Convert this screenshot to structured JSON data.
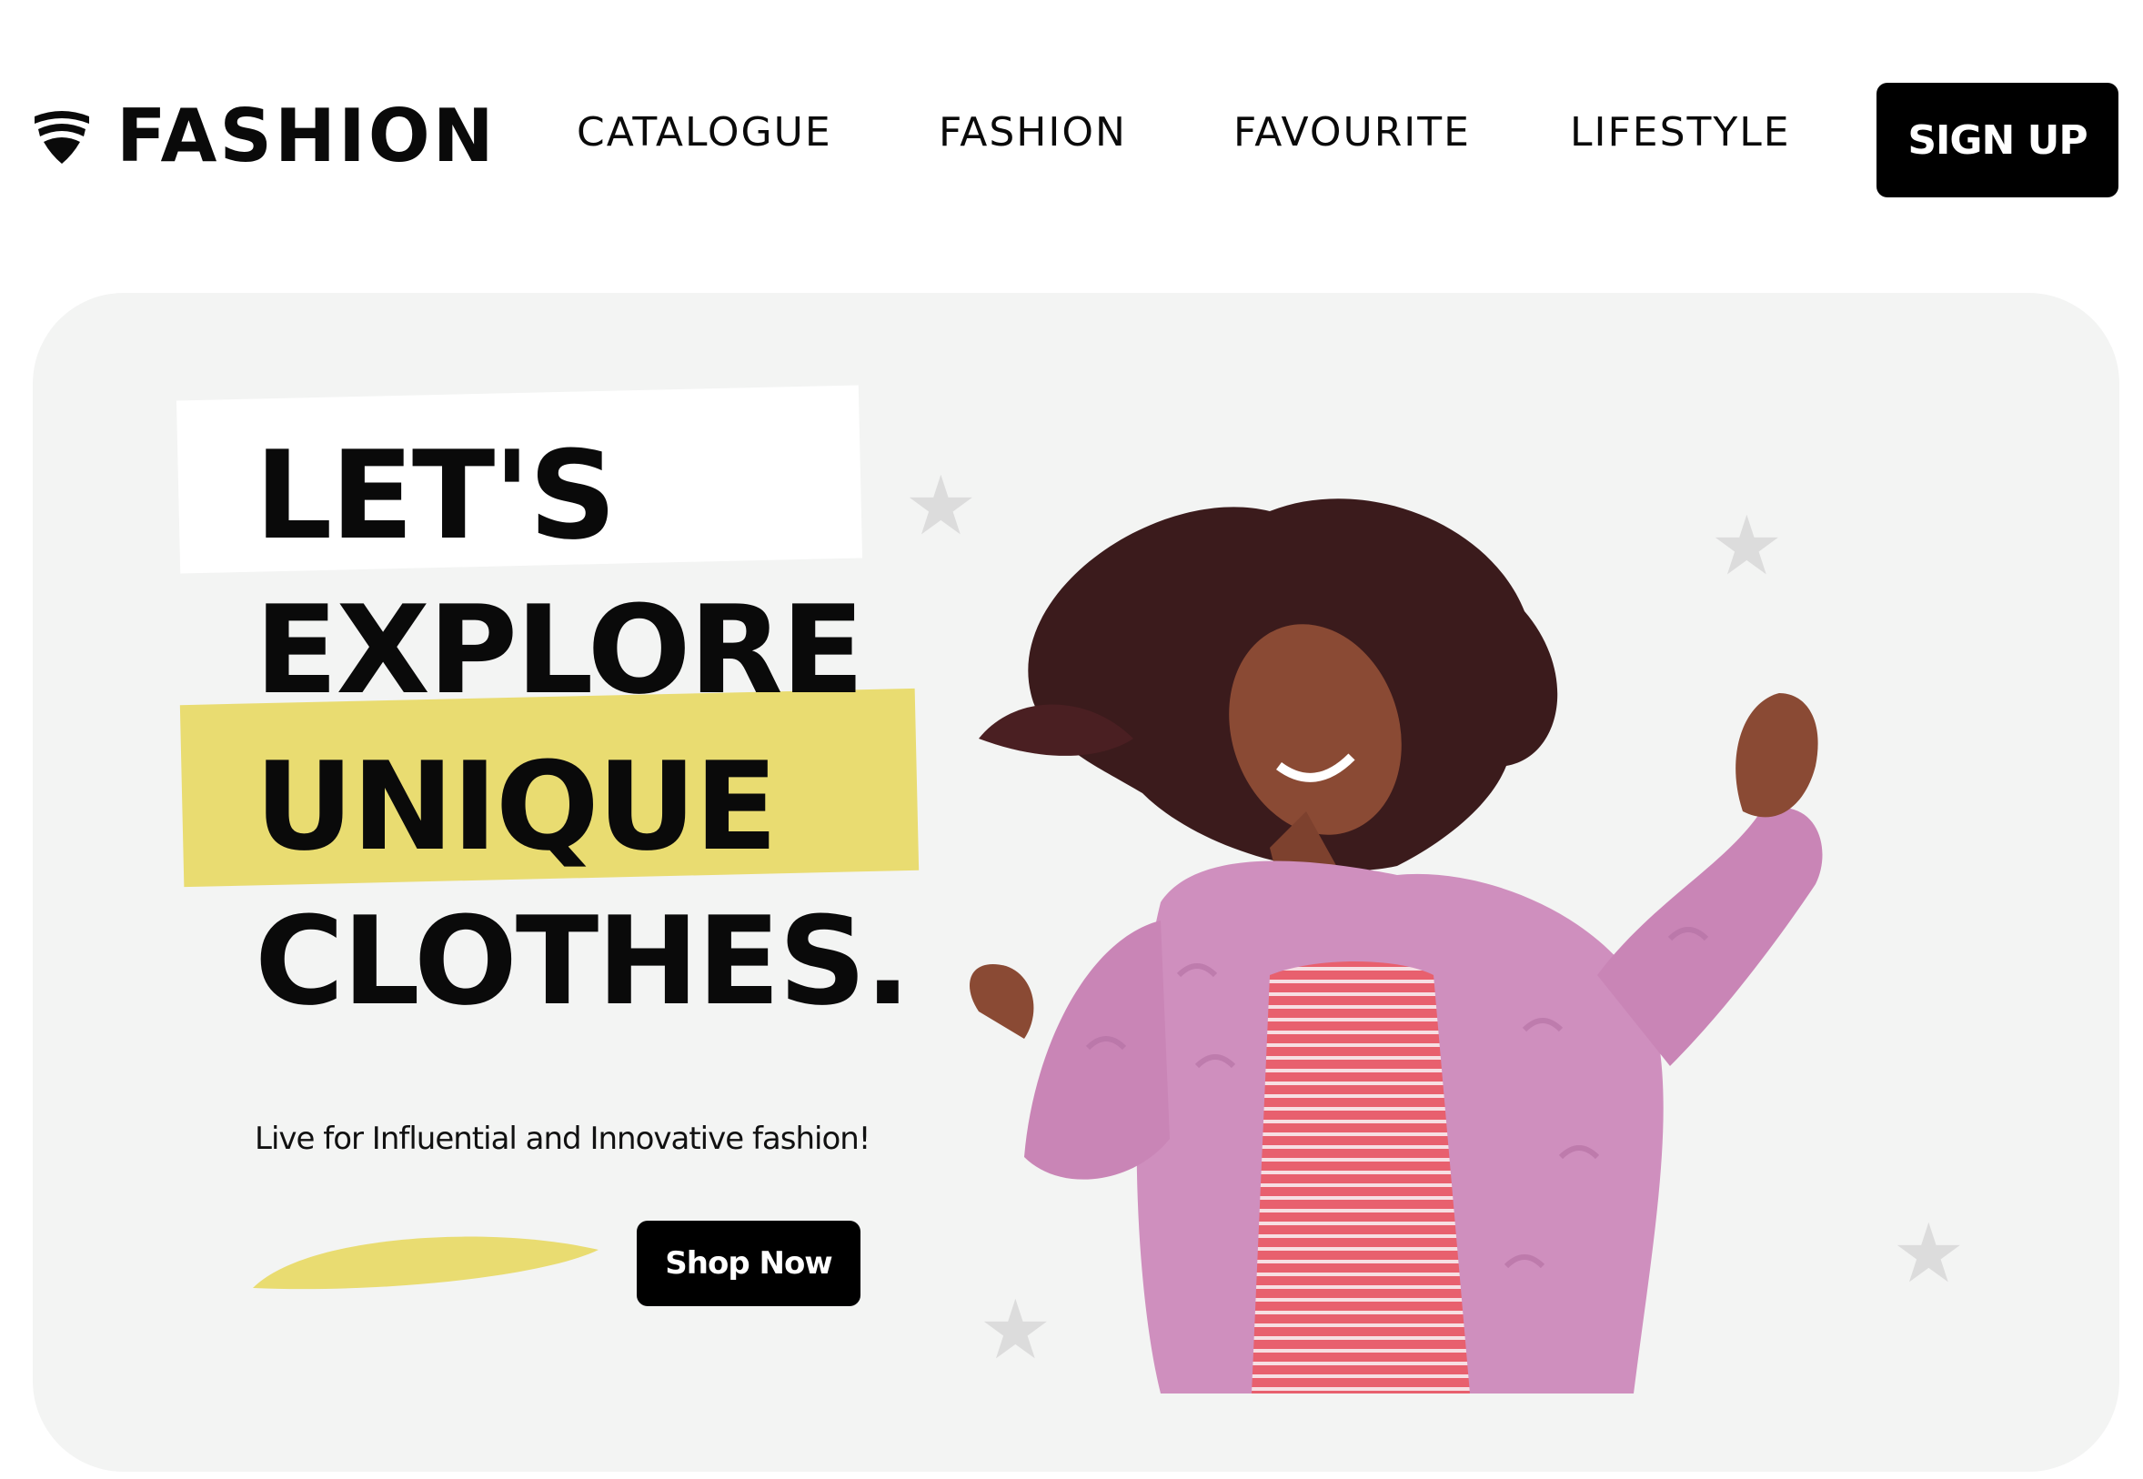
{
  "brand": {
    "name": "FASHION",
    "icon": "fashion-logo-icon"
  },
  "nav": {
    "items": [
      {
        "label": "CATALOGUE"
      },
      {
        "label": "FASHION"
      },
      {
        "label": "FAVOURITE"
      },
      {
        "label": "LIFESTYLE"
      }
    ],
    "signup_label": "SIGN UP"
  },
  "hero": {
    "headline": [
      "LET'S",
      "EXPLORE",
      "UNIQUE",
      "CLOTHES."
    ],
    "tagline": "Live for Influential and Innovative fashion!",
    "cta_label": "Shop Now",
    "image": "woman-in-pink-fur-coat-dancing",
    "decorations": [
      "star-icon",
      "star-icon",
      "star-icon",
      "star-icon"
    ]
  },
  "colors": {
    "accent_yellow": "#e9dc71",
    "hero_background": "#f3f4f3",
    "button_background": "#000000",
    "text": "#0a0a0a"
  }
}
